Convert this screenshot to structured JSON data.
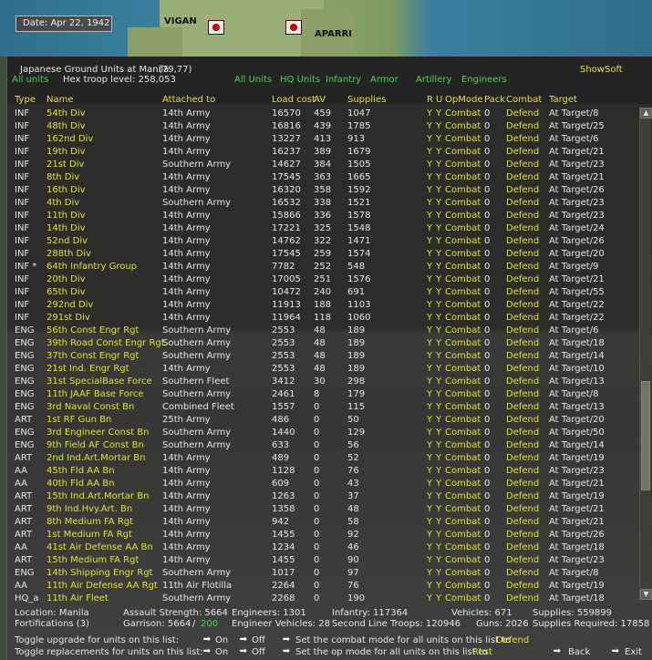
{
  "map": {
    "date": "Date: Apr 22, 1942",
    "labels": [
      "VIGAN",
      "APARRI"
    ]
  },
  "header": {
    "title": "Japanese Ground Units at Manila",
    "coords": "(79,77)",
    "hex_troop_level": "Hex troop level: 258,053",
    "show_soft": "ShowSoft",
    "filters": {
      "all_units_left": "All units",
      "all_units": "All Units",
      "hq_units": "HQ Units",
      "infantry": "Infantry",
      "armor": "Armor",
      "artillery": "Artillery",
      "engineers": "Engineers"
    }
  },
  "columns": {
    "type": "Type",
    "name": "Name",
    "attached": "Attached to",
    "load": "Load cost",
    "av": "AV",
    "supplies": "Supplies",
    "r": "R",
    "u": "U",
    "opmode": "OpMode",
    "pack": "Pack",
    "combat": "Combat",
    "target": "Target"
  },
  "rows": [
    {
      "type": "INF",
      "name": "54th Div",
      "att": "14th Army",
      "load": "16570",
      "av": "459",
      "sup": "1047",
      "r": "Y",
      "u": "Y",
      "op": "Combat",
      "pack": "0",
      "comb": "Defend",
      "tgt": "At Target/8"
    },
    {
      "type": "INF",
      "name": "48th Div",
      "att": "14th Army",
      "load": "16816",
      "av": "439",
      "sup": "1785",
      "r": "Y",
      "u": "Y",
      "op": "Combat",
      "pack": "0",
      "comb": "Defend",
      "tgt": "At Target/25"
    },
    {
      "type": "INF",
      "name": "162nd Div",
      "att": "14th Army",
      "load": "13227",
      "av": "413",
      "sup": "913",
      "r": "Y",
      "u": "Y",
      "op": "Combat",
      "pack": "0",
      "comb": "Defend",
      "tgt": "At Target/6"
    },
    {
      "type": "INF",
      "name": "19th Div",
      "att": "14th Army",
      "load": "16237",
      "av": "389",
      "sup": "1679",
      "r": "Y",
      "u": "Y",
      "op": "Combat",
      "pack": "0",
      "comb": "Defend",
      "tgt": "At Target/21"
    },
    {
      "type": "INF",
      "name": "21st Div",
      "att": "Southern Army",
      "load": "14627",
      "av": "384",
      "sup": "1505",
      "r": "Y",
      "u": "Y",
      "op": "Combat",
      "pack": "0",
      "comb": "Defend",
      "tgt": "At Target/23"
    },
    {
      "type": "INF",
      "name": "8th Div",
      "att": "14th Army",
      "load": "17545",
      "av": "363",
      "sup": "1665",
      "r": "Y",
      "u": "Y",
      "op": "Combat",
      "pack": "0",
      "comb": "Defend",
      "tgt": "At Target/21"
    },
    {
      "type": "INF",
      "name": "16th Div",
      "att": "14th Army",
      "load": "16320",
      "av": "358",
      "sup": "1592",
      "r": "Y",
      "u": "Y",
      "op": "Combat",
      "pack": "0",
      "comb": "Defend",
      "tgt": "At Target/26"
    },
    {
      "type": "INF",
      "name": "4th Div",
      "att": "Southern Army",
      "load": "16532",
      "av": "338",
      "sup": "1521",
      "r": "Y",
      "u": "Y",
      "op": "Combat",
      "pack": "0",
      "comb": "Defend",
      "tgt": "At Target/23"
    },
    {
      "type": "INF",
      "name": "11th Div",
      "att": "14th Army",
      "load": "15866",
      "av": "336",
      "sup": "1578",
      "r": "Y",
      "u": "Y",
      "op": "Combat",
      "pack": "0",
      "comb": "Defend",
      "tgt": "At Target/23"
    },
    {
      "type": "INF",
      "name": "14th Div",
      "att": "14th Army",
      "load": "17221",
      "av": "325",
      "sup": "1548",
      "r": "Y",
      "u": "Y",
      "op": "Combat",
      "pack": "0",
      "comb": "Defend",
      "tgt": "At Target/24"
    },
    {
      "type": "INF",
      "name": "52nd Div",
      "att": "14th Army",
      "load": "14762",
      "av": "322",
      "sup": "1471",
      "r": "Y",
      "u": "Y",
      "op": "Combat",
      "pack": "0",
      "comb": "Defend",
      "tgt": "At Target/26"
    },
    {
      "type": "INF",
      "name": "288th Div",
      "att": "14th Army",
      "load": "17545",
      "av": "259",
      "sup": "1574",
      "r": "Y",
      "u": "Y",
      "op": "Combat",
      "pack": "0",
      "comb": "Defend",
      "tgt": "At Target/20"
    },
    {
      "type": "INF *",
      "name": "64th Infantry Group",
      "att": "14th Army",
      "load": "7782",
      "av": "252",
      "sup": "548",
      "r": "Y",
      "u": "Y",
      "op": "Combat",
      "pack": "0",
      "comb": "Defend",
      "tgt": "At Target/9"
    },
    {
      "type": "INF",
      "name": "20th Div",
      "att": "14th Army",
      "load": "17005",
      "av": "251",
      "sup": "1576",
      "r": "Y",
      "u": "Y",
      "op": "Combat",
      "pack": "0",
      "comb": "Defend",
      "tgt": "At Target/21"
    },
    {
      "type": "INF",
      "name": "65th Div",
      "att": "14th Army",
      "load": "10472",
      "av": "240",
      "sup": "691",
      "r": "Y",
      "u": "Y",
      "op": "Combat",
      "pack": "0",
      "comb": "Defend",
      "tgt": "At Target/55"
    },
    {
      "type": "INF",
      "name": "292nd Div",
      "att": "14th Army",
      "load": "11913",
      "av": "188",
      "sup": "1103",
      "r": "Y",
      "u": "Y",
      "op": "Combat",
      "pack": "0",
      "comb": "Defend",
      "tgt": "At Target/22"
    },
    {
      "type": "INF",
      "name": "291st Div",
      "att": "14th Army",
      "load": "11964",
      "av": "118",
      "sup": "1060",
      "r": "Y",
      "u": "Y",
      "op": "Combat",
      "pack": "0",
      "comb": "Defend",
      "tgt": "At Target/22"
    },
    {
      "type": "ENG",
      "name": "56th Const Engr Rgt",
      "att": "Southern Army",
      "load": "2553",
      "av": "48",
      "sup": "189",
      "r": "Y",
      "u": "Y",
      "op": "Combat",
      "pack": "0",
      "comb": "Defend",
      "tgt": "At Target/6"
    },
    {
      "type": "ENG",
      "name": "39th Road Const Engr Rgt",
      "att": "Southern Army",
      "load": "2553",
      "av": "48",
      "sup": "189",
      "r": "Y",
      "u": "Y",
      "op": "Combat",
      "pack": "0",
      "comb": "Defend",
      "tgt": "At Target/18"
    },
    {
      "type": "ENG",
      "name": "37th Const Engr Rgt",
      "att": "Southern Army",
      "load": "2553",
      "av": "48",
      "sup": "189",
      "r": "Y",
      "u": "Y",
      "op": "Combat",
      "pack": "0",
      "comb": "Defend",
      "tgt": "At Target/14"
    },
    {
      "type": "ENG",
      "name": "21st Ind. Engr Rgt",
      "att": "14th Army",
      "load": "2553",
      "av": "48",
      "sup": "189",
      "r": "Y",
      "u": "Y",
      "op": "Combat",
      "pack": "0",
      "comb": "Defend",
      "tgt": "At Target/10"
    },
    {
      "type": "ENG",
      "name": "31st SpecialBase Force",
      "att": "Southern Fleet",
      "load": "3412",
      "av": "30",
      "sup": "298",
      "r": "Y",
      "u": "Y",
      "op": "Combat",
      "pack": "0",
      "comb": "Defend",
      "tgt": "At Target/13"
    },
    {
      "type": "ENG",
      "name": "11th JAAF Base Force",
      "att": "Southern Army",
      "load": "2461",
      "av": "8",
      "sup": "179",
      "r": "Y",
      "u": "Y",
      "op": "Combat",
      "pack": "0",
      "comb": "Defend",
      "tgt": "At Target/8"
    },
    {
      "type": "ENG",
      "name": "3rd Naval Const Bn",
      "att": "Combined Fleet",
      "load": "1557",
      "av": "0",
      "sup": "115",
      "r": "Y",
      "u": "Y",
      "op": "Combat",
      "pack": "0",
      "comb": "Defend",
      "tgt": "At Target/13"
    },
    {
      "type": "ART",
      "name": "1st RF Gun Bn",
      "att": "25th Army",
      "load": "486",
      "av": "0",
      "sup": "50",
      "r": "Y",
      "u": "Y",
      "op": "Combat",
      "pack": "0",
      "comb": "Defend",
      "tgt": "At Target/20"
    },
    {
      "type": "ENG",
      "name": "3rd Engineer Const Bn",
      "att": "Southern Army",
      "load": "1440",
      "av": "0",
      "sup": "129",
      "r": "Y",
      "u": "Y",
      "op": "Combat",
      "pack": "0",
      "comb": "Defend",
      "tgt": "At Target/50"
    },
    {
      "type": "ENG",
      "name": "9th Field AF Const Bn",
      "att": "Southern Army",
      "load": "633",
      "av": "0",
      "sup": "56",
      "r": "Y",
      "u": "Y",
      "op": "Combat",
      "pack": "0",
      "comb": "Defend",
      "tgt": "At Target/14"
    },
    {
      "type": "ART",
      "name": "2nd Ind.Art.Mortar Bn",
      "att": "14th Army",
      "load": "489",
      "av": "0",
      "sup": "52",
      "r": "Y",
      "u": "Y",
      "op": "Combat",
      "pack": "0",
      "comb": "Defend",
      "tgt": "At Target/19"
    },
    {
      "type": "AA",
      "name": "45th Fld AA Bn",
      "att": "14th Army",
      "load": "1128",
      "av": "0",
      "sup": "76",
      "r": "Y",
      "u": "Y",
      "op": "Combat",
      "pack": "0",
      "comb": "Defend",
      "tgt": "At Target/23"
    },
    {
      "type": "AA",
      "name": "40th Fld AA Bn",
      "att": "14th Army",
      "load": "609",
      "av": "0",
      "sup": "43",
      "r": "Y",
      "u": "Y",
      "op": "Combat",
      "pack": "0",
      "comb": "Defend",
      "tgt": "At Target/21"
    },
    {
      "type": "ART",
      "name": "15th Ind.Art.Mortar Bn",
      "att": "14th Army",
      "load": "1263",
      "av": "0",
      "sup": "37",
      "r": "Y",
      "u": "Y",
      "op": "Combat",
      "pack": "0",
      "comb": "Defend",
      "tgt": "At Target/19"
    },
    {
      "type": "ART",
      "name": "9th Ind.Hvy.Art. Bn",
      "att": "14th Army",
      "load": "1358",
      "av": "0",
      "sup": "48",
      "r": "Y",
      "u": "Y",
      "op": "Combat",
      "pack": "0",
      "comb": "Defend",
      "tgt": "At Target/21"
    },
    {
      "type": "ART",
      "name": "8th Medium FA Rgt",
      "att": "14th Army",
      "load": "942",
      "av": "0",
      "sup": "58",
      "r": "Y",
      "u": "Y",
      "op": "Combat",
      "pack": "0",
      "comb": "Defend",
      "tgt": "At Target/21"
    },
    {
      "type": "ART",
      "name": "1st Medium FA Rgt",
      "att": "14th Army",
      "load": "1455",
      "av": "0",
      "sup": "92",
      "r": "Y",
      "u": "Y",
      "op": "Combat",
      "pack": "0",
      "comb": "Defend",
      "tgt": "At Target/26"
    },
    {
      "type": "AA",
      "name": "41st Air Defense AA Bn",
      "att": "14th Army",
      "load": "1234",
      "av": "0",
      "sup": "46",
      "r": "Y",
      "u": "Y",
      "op": "Combat",
      "pack": "0",
      "comb": "Defend",
      "tgt": "At Target/18"
    },
    {
      "type": "ART",
      "name": "15th Medium FA Rgt",
      "att": "14th Army",
      "load": "1455",
      "av": "0",
      "sup": "90",
      "r": "Y",
      "u": "Y",
      "op": "Combat",
      "pack": "0",
      "comb": "Defend",
      "tgt": "At Target/23"
    },
    {
      "type": "ENG",
      "name": "14th Shipping Engr Rgt",
      "att": "Southern Army",
      "load": "1017",
      "av": "0",
      "sup": "97",
      "r": "Y",
      "u": "Y",
      "op": "Combat",
      "pack": "0",
      "comb": "Defend",
      "tgt": "At Target/8"
    },
    {
      "type": "AA",
      "name": "11th Air Defense AA Rgt",
      "att": "11th Air Flotilla",
      "load": "2264",
      "av": "0",
      "sup": "76",
      "r": "Y",
      "u": "Y",
      "op": "Combat",
      "pack": "0",
      "comb": "Defend",
      "tgt": "At Target/19"
    },
    {
      "type": "HQ_a",
      "name": "11th Air Fleet",
      "att": "Southern Army",
      "load": "2268",
      "av": "0",
      "sup": "190",
      "r": "Y",
      "u": "Y",
      "op": "Combat",
      "pack": "0",
      "comb": "Defend",
      "tgt": "At Target/18"
    }
  ],
  "footer": {
    "location": "Location: Manila",
    "fortifications": "Fortifications (3)",
    "assault_strength": "Assault Strength: 5664",
    "garrison_label": "Garrison: 5664",
    "garrison_sep": "/",
    "garrison_req": "200",
    "engineers": "Engineers: 1301",
    "engineer_vehicles": "Engineer Vehicles: 28",
    "infantry": "Infantry: 117364",
    "second_line": "Second Line Troops: 120946",
    "guns": "Guns: 2026",
    "vehicles": "Vehicles: 671",
    "supplies": "Supplies: 559899",
    "supplies_required": "Supplies Required: 17858",
    "toggle_upgrade": "Toggle upgrade for units on this list:",
    "toggle_replacements": "Toggle replacements for units on this list:",
    "on": "On",
    "off": "Off",
    "set_combat": "Set the combat mode for all units on this list to",
    "set_combat_value": "Defend",
    "set_op": "Set the op mode for all units on this list to",
    "set_op_value": "Rest",
    "back": "Back",
    "exit": "Exit"
  }
}
